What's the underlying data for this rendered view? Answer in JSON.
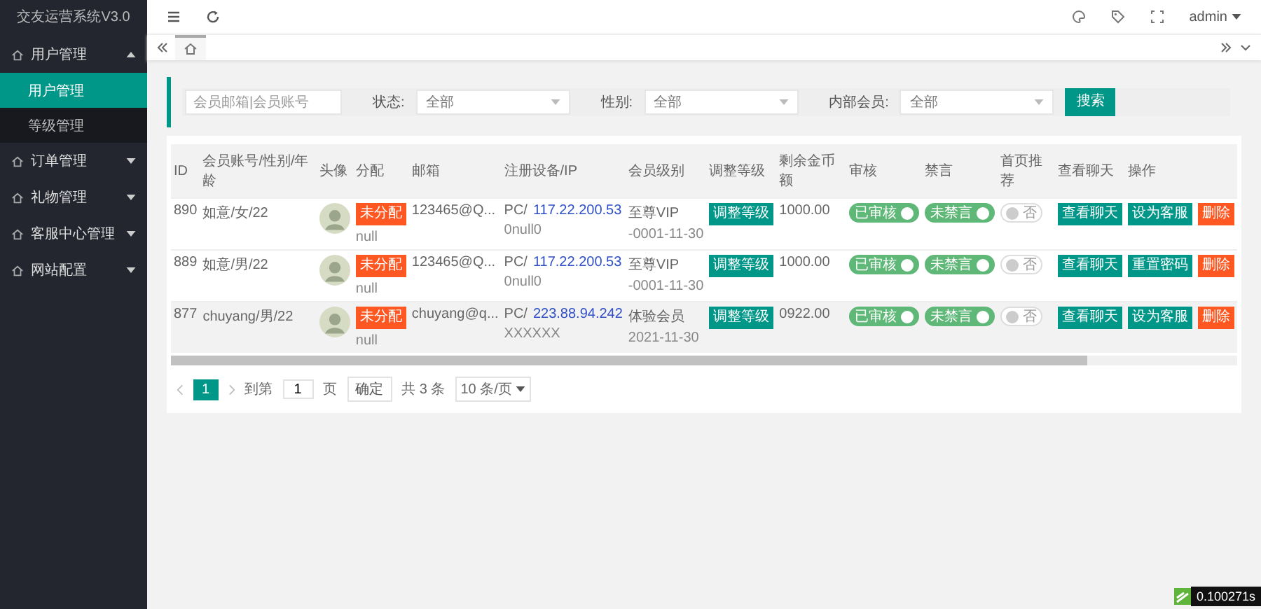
{
  "sidebar": {
    "title": "交友运营系统V3.0",
    "items": [
      {
        "label": "用户管理",
        "expanded": true,
        "children": [
          {
            "label": "用户管理",
            "selected": true
          },
          {
            "label": "等级管理",
            "selected": false
          }
        ]
      },
      {
        "label": "订单管理",
        "expanded": false
      },
      {
        "label": "礼物管理",
        "expanded": false
      },
      {
        "label": "客服中心管理",
        "expanded": false
      },
      {
        "label": "网站配置",
        "expanded": false
      }
    ]
  },
  "header": {
    "user": "admin"
  },
  "tabs": [
    {
      "kind": "home",
      "selected": true
    }
  ],
  "filters": {
    "search": {
      "placeholder": "会员邮箱|会员账号"
    },
    "selects": [
      {
        "label": "状态:",
        "value": "全部"
      },
      {
        "label": "性别:",
        "value": "全部"
      },
      {
        "label": "内部会员:",
        "value": "全部"
      }
    ],
    "button": "搜索"
  },
  "table": {
    "columns": [
      "ID",
      "会员账号/性别/年龄",
      "头像",
      "分配",
      "邮箱",
      "注册设备/IP",
      "会员级别",
      "调整等级",
      "剩余金币额",
      "审核",
      "禁言",
      "首页推荐",
      "查看聊天",
      "操作"
    ],
    "rows": [
      {
        "selected": false,
        "id": "890",
        "account": "如意/女/22",
        "assign": "未分配",
        "assign_note": "null",
        "email": "123465@Q...",
        "device": "PC/",
        "ip": "117.22.200.53",
        "device_note": "0null0",
        "level": "至尊VIP",
        "level_date": "-0001-11-30",
        "adjust": "调整等级",
        "coins": "1000.00",
        "audit": {
          "label": "已审核",
          "on": true
        },
        "mute": {
          "label": "未禁言",
          "on": true
        },
        "recommend": {
          "label": "否",
          "on": false
        },
        "chat": "查看聊天",
        "actions": [
          "设为客服",
          "删除"
        ]
      },
      {
        "selected": false,
        "id": "889",
        "account": "如意/男/22",
        "assign": "未分配",
        "assign_note": "null",
        "email": "123465@Q...",
        "device": "PC/",
        "ip": "117.22.200.53",
        "device_note": "0null0",
        "level": "至尊VIP",
        "level_date": "-0001-11-30",
        "adjust": "调整等级",
        "coins": "1000.00",
        "audit": {
          "label": "已审核",
          "on": true
        },
        "mute": {
          "label": "未禁言",
          "on": true
        },
        "recommend": {
          "label": "否",
          "on": false
        },
        "chat": "查看聊天",
        "actions": [
          "重置密码",
          "删除"
        ]
      },
      {
        "selected": true,
        "id": "877",
        "account": "chuyang/男/22",
        "assign": "未分配",
        "assign_note": "null",
        "email": "chuyang@q...",
        "device": "PC/",
        "ip": "223.88.94.242",
        "device_note": "XXXXXX",
        "level": "体验会员",
        "level_date": "2021-11-30",
        "adjust": "调整等级",
        "coins": "0922.00",
        "audit": {
          "label": "已审核",
          "on": true
        },
        "mute": {
          "label": "未禁言",
          "on": true
        },
        "recommend": {
          "label": "否",
          "on": false
        },
        "chat": "查看聊天",
        "actions": [
          "设为客服",
          "删除"
        ]
      }
    ]
  },
  "pagination": {
    "pages": [
      {
        "label": "1",
        "selected": true
      }
    ],
    "goto_label": "到第",
    "goto_value": "1",
    "page_unit": "页",
    "confirm": "确定",
    "total": "共 3 条",
    "page_size": "10 条/页"
  },
  "timer": "0.100271s"
}
